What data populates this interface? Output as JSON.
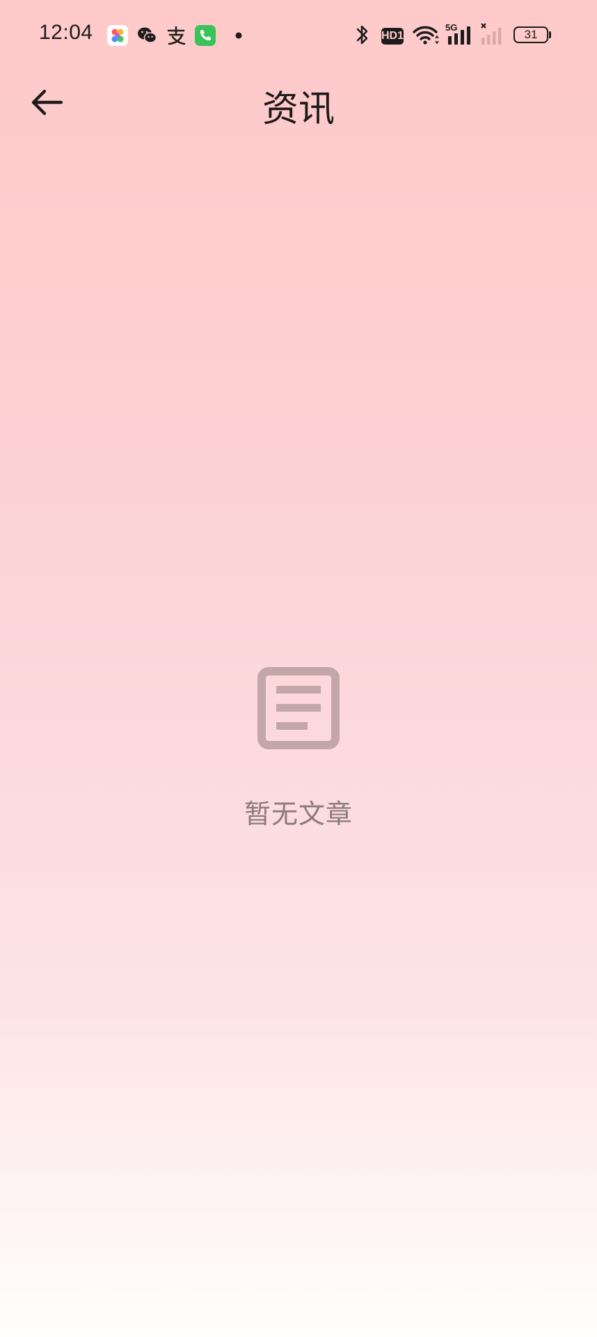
{
  "status_bar": {
    "time": "12:04",
    "notification_icons": [
      "photos-app-icon",
      "wechat-icon",
      "alipay-icon",
      "phone-icon",
      "more-dot-icon"
    ],
    "system_icons": [
      "bluetooth-icon",
      "hd-icon",
      "wifi-icon",
      "signal-5g-icon",
      "signal-sim2-icon"
    ],
    "hd_label": "HD1",
    "network_label": "5G",
    "battery_level": "31"
  },
  "header": {
    "title": "资讯"
  },
  "empty_state": {
    "message": "暂无文章",
    "icon": "article-icon"
  },
  "colors": {
    "gradient_top": "#ffc9c9",
    "gradient_bottom": "#fffefc",
    "empty_icon": "#c3a6a8",
    "empty_text": "#8c7b7b",
    "text_dark": "#1f1a1a"
  }
}
